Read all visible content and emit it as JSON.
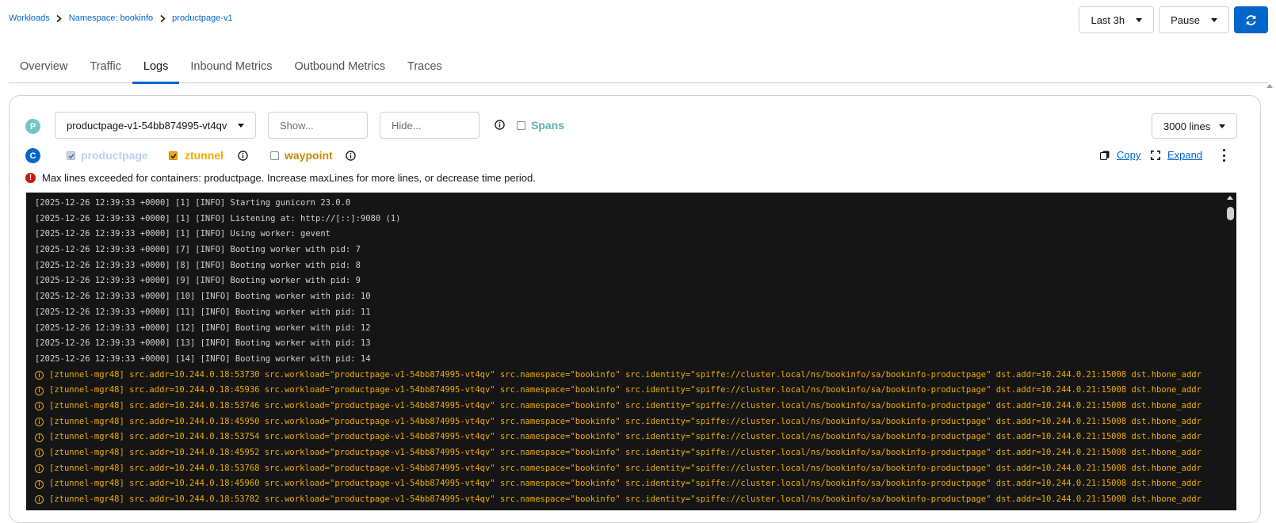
{
  "breadcrumb": {
    "workloads": "Workloads",
    "namespace": "Namespace: bookinfo",
    "current": "productpage-v1"
  },
  "controls": {
    "time_range": "Last 3h",
    "refresh_interval": "Pause",
    "refresh_icon": "refresh-icon"
  },
  "tabs": [
    {
      "label": "Overview"
    },
    {
      "label": "Traffic"
    },
    {
      "label": "Logs"
    },
    {
      "label": "Inbound Metrics"
    },
    {
      "label": "Outbound Metrics"
    },
    {
      "label": "Traces"
    }
  ],
  "active_tab": "Logs",
  "logs": {
    "pod_badge": "P",
    "pod_select": "productpage-v1-54bb874995-vt4qv",
    "show_placeholder": "Show...",
    "hide_placeholder": "Hide...",
    "spans_label": "Spans",
    "lines_select": "3000 lines",
    "container_badge": "C",
    "containers": [
      {
        "label": "productpage",
        "checked": true,
        "color": "#b8d4ec"
      },
      {
        "label": "ztunnel",
        "checked": true,
        "color": "#f0ab00"
      },
      {
        "label": "waypoint",
        "checked": false,
        "color": "#c58c00"
      }
    ],
    "copy_label": "Copy",
    "expand_label": "Expand",
    "warning": "Max lines exceeded for containers: productpage. Increase maxLines for more lines, or decrease time period.",
    "lines": [
      {
        "text": "[2025-12-26 12:39:33 +0000] [1] [INFO] Starting gunicorn 23.0.0",
        "kind": "app"
      },
      {
        "text": "[2025-12-26 12:39:33 +0000] [1] [INFO] Listening at: http://[::]:9080 (1)",
        "kind": "app"
      },
      {
        "text": "[2025-12-26 12:39:33 +0000] [1] [INFO] Using worker: gevent",
        "kind": "app"
      },
      {
        "text": "[2025-12-26 12:39:33 +0000] [7] [INFO] Booting worker with pid: 7",
        "kind": "app"
      },
      {
        "text": "[2025-12-26 12:39:33 +0000] [8] [INFO] Booting worker with pid: 8",
        "kind": "app"
      },
      {
        "text": "[2025-12-26 12:39:33 +0000] [9] [INFO] Booting worker with pid: 9",
        "kind": "app"
      },
      {
        "text": "[2025-12-26 12:39:33 +0000] [10] [INFO] Booting worker with pid: 10",
        "kind": "app"
      },
      {
        "text": "[2025-12-26 12:39:33 +0000] [11] [INFO] Booting worker with pid: 11",
        "kind": "app"
      },
      {
        "text": "[2025-12-26 12:39:33 +0000] [12] [INFO] Booting worker with pid: 12",
        "kind": "app"
      },
      {
        "text": "[2025-12-26 12:39:33 +0000] [13] [INFO] Booting worker with pid: 13",
        "kind": "app"
      },
      {
        "text": "[2025-12-26 12:39:33 +0000] [14] [INFO] Booting worker with pid: 14",
        "kind": "app"
      },
      {
        "text": "[ztunnel-mgr48] src.addr=10.244.0.18:53730 src.workload=\"productpage-v1-54bb874995-vt4qv\" src.namespace=\"bookinfo\" src.identity=\"spiffe://cluster.local/ns/bookinfo/sa/bookinfo-productpage\" dst.addr=10.244.0.21:15008 dst.hbone_addr",
        "kind": "ztunnel"
      },
      {
        "text": "[ztunnel-mgr48] src.addr=10.244.0.18:45936 src.workload=\"productpage-v1-54bb874995-vt4qv\" src.namespace=\"bookinfo\" src.identity=\"spiffe://cluster.local/ns/bookinfo/sa/bookinfo-productpage\" dst.addr=10.244.0.21:15008 dst.hbone_addr",
        "kind": "ztunnel"
      },
      {
        "text": "[ztunnel-mgr48] src.addr=10.244.0.18:53746 src.workload=\"productpage-v1-54bb874995-vt4qv\" src.namespace=\"bookinfo\" src.identity=\"spiffe://cluster.local/ns/bookinfo/sa/bookinfo-productpage\" dst.addr=10.244.0.21:15008 dst.hbone_addr",
        "kind": "ztunnel"
      },
      {
        "text": "[ztunnel-mgr48] src.addr=10.244.0.18:45950 src.workload=\"productpage-v1-54bb874995-vt4qv\" src.namespace=\"bookinfo\" src.identity=\"spiffe://cluster.local/ns/bookinfo/sa/bookinfo-productpage\" dst.addr=10.244.0.21:15008 dst.hbone_addr",
        "kind": "ztunnel"
      },
      {
        "text": "[ztunnel-mgr48] src.addr=10.244.0.18:53754 src.workload=\"productpage-v1-54bb874995-vt4qv\" src.namespace=\"bookinfo\" src.identity=\"spiffe://cluster.local/ns/bookinfo/sa/bookinfo-productpage\" dst.addr=10.244.0.21:15008 dst.hbone_addr",
        "kind": "ztunnel"
      },
      {
        "text": "[ztunnel-mgr48] src.addr=10.244.0.18:45952 src.workload=\"productpage-v1-54bb874995-vt4qv\" src.namespace=\"bookinfo\" src.identity=\"spiffe://cluster.local/ns/bookinfo/sa/bookinfo-productpage\" dst.addr=10.244.0.21:15008 dst.hbone_addr",
        "kind": "ztunnel"
      },
      {
        "text": "[ztunnel-mgr48] src.addr=10.244.0.18:53768 src.workload=\"productpage-v1-54bb874995-vt4qv\" src.namespace=\"bookinfo\" src.identity=\"spiffe://cluster.local/ns/bookinfo/sa/bookinfo-productpage\" dst.addr=10.244.0.21:15008 dst.hbone_addr",
        "kind": "ztunnel"
      },
      {
        "text": "[ztunnel-mgr48] src.addr=10.244.0.18:45960 src.workload=\"productpage-v1-54bb874995-vt4qv\" src.namespace=\"bookinfo\" src.identity=\"spiffe://cluster.local/ns/bookinfo/sa/bookinfo-productpage\" dst.addr=10.244.0.21:15008 dst.hbone_addr",
        "kind": "ztunnel"
      },
      {
        "text": "[ztunnel-mgr48] src.addr=10.244.0.18:53782 src.workload=\"productpage-v1-54bb874995-vt4qv\" src.namespace=\"bookinfo\" src.identity=\"spiffe://cluster.local/ns/bookinfo/sa/bookinfo-productpage\" dst.addr=10.244.0.21:15008 dst.hbone_addr",
        "kind": "ztunnel"
      }
    ]
  }
}
